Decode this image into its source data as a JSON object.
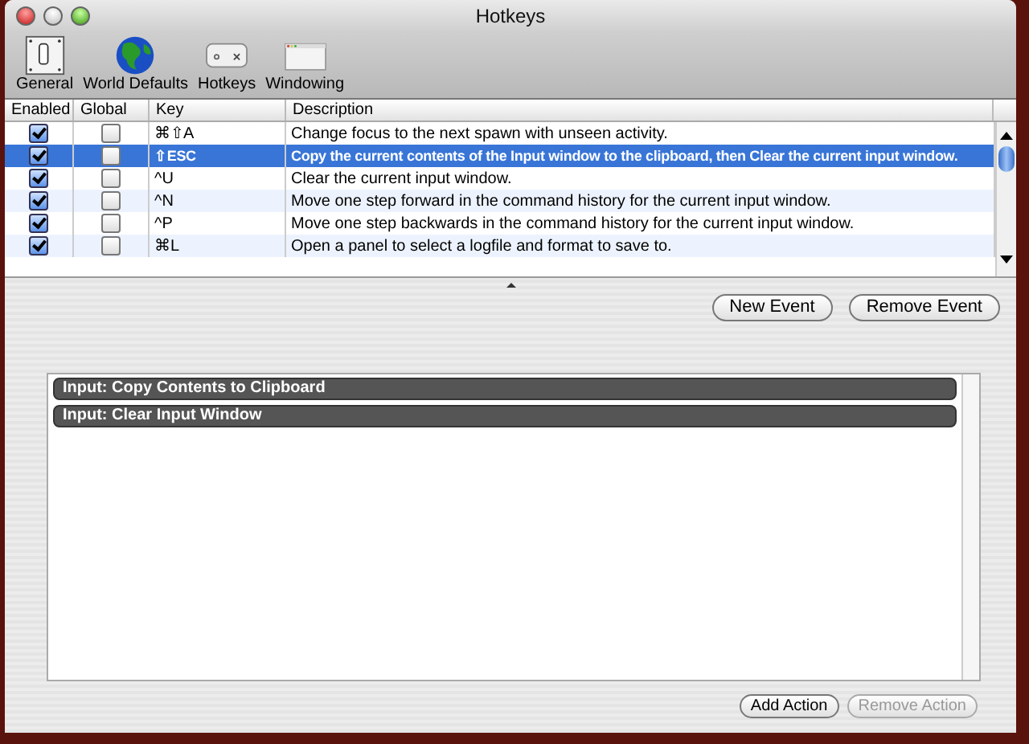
{
  "window": {
    "title": "Hotkeys"
  },
  "toolbar": [
    {
      "label": "General",
      "kind": "switch"
    },
    {
      "label": "World Defaults",
      "kind": "globe"
    },
    {
      "label": "Hotkeys",
      "kind": "keyboard"
    },
    {
      "label": "Windowing",
      "kind": "window"
    }
  ],
  "table": {
    "columns": [
      "Enabled",
      "Global",
      "Key",
      "Description"
    ],
    "rows": [
      {
        "enabled": true,
        "global": false,
        "key": "⌘⇧A",
        "description": "Change focus to the next spawn with unseen activity.",
        "selected": false
      },
      {
        "enabled": true,
        "global": false,
        "key": "⇧ESC",
        "description": "Copy the current contents of the Input window to the clipboard, then Clear the current input window.",
        "selected": true
      },
      {
        "enabled": true,
        "global": false,
        "key": "^U",
        "description": "Clear the current input window.",
        "selected": false
      },
      {
        "enabled": true,
        "global": false,
        "key": "^N",
        "description": "Move one step forward in the command history for the current input window.",
        "selected": false
      },
      {
        "enabled": true,
        "global": false,
        "key": "^P",
        "description": "Move one step backwards in the command history for the current input window.",
        "selected": false
      },
      {
        "enabled": true,
        "global": false,
        "key": "⌘L",
        "description": "Open a panel to select a logfile and format to save to.",
        "selected": false
      }
    ]
  },
  "event_buttons": [
    {
      "label": "New Event",
      "disabled": false
    },
    {
      "label": "Remove Event",
      "disabled": false
    }
  ],
  "actions": [
    "Input: Copy Contents to Clipboard",
    "Input: Clear Input Window"
  ],
  "action_buttons": [
    {
      "label": "Add Action",
      "disabled": false
    },
    {
      "label": "Remove Action",
      "disabled": true
    }
  ]
}
